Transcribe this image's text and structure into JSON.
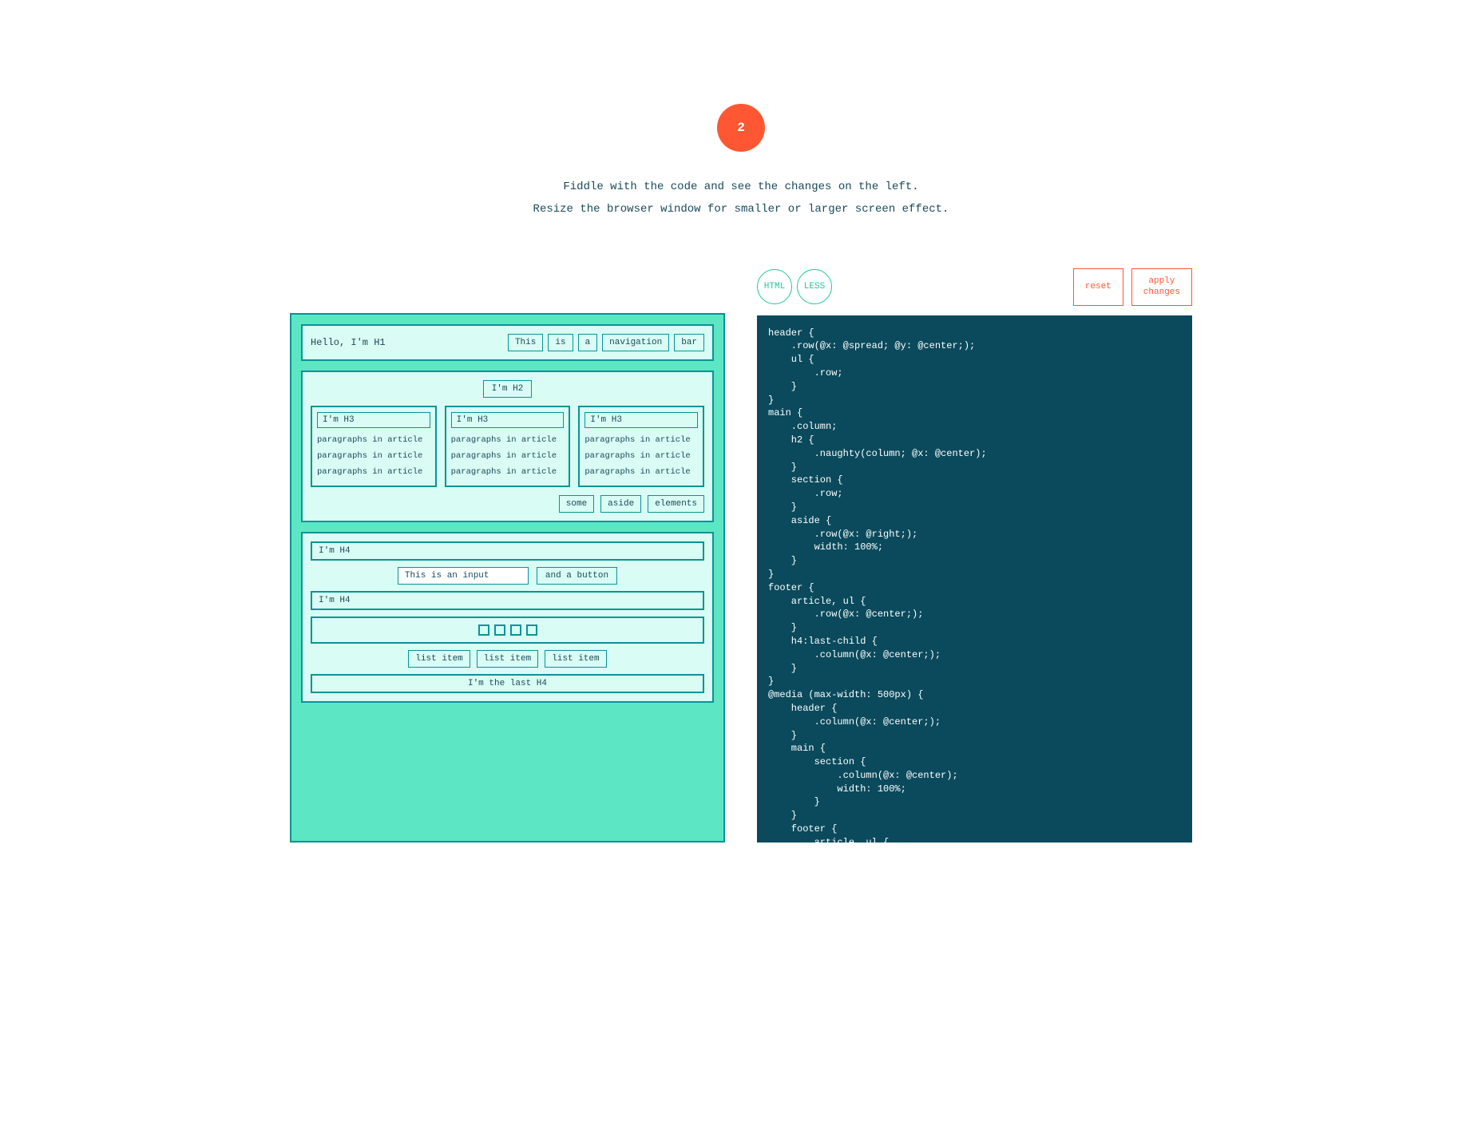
{
  "step": "2",
  "instructions": {
    "line1": "Fiddle with the code and see the changes on the left.",
    "line2": "Resize the browser window for smaller or larger screen effect."
  },
  "tabs": {
    "html": "HTML",
    "less": "LESS"
  },
  "actions": {
    "reset": "reset",
    "apply": "apply\nchanges"
  },
  "preview": {
    "h1": "Hello, I'm H1",
    "nav": [
      "This",
      "is",
      "a",
      "navigation",
      "bar"
    ],
    "h2": "I'm H2",
    "articles": [
      {
        "h3": "I'm H3",
        "p": [
          "paragraphs in article",
          "paragraphs in article",
          "paragraphs in article"
        ]
      },
      {
        "h3": "I'm H3",
        "p": [
          "paragraphs in article",
          "paragraphs in article",
          "paragraphs in article"
        ]
      },
      {
        "h3": "I'm H3",
        "p": [
          "paragraphs in article",
          "paragraphs in article",
          "paragraphs in article"
        ]
      }
    ],
    "aside": [
      "some",
      "aside",
      "elements"
    ],
    "footer": {
      "h4a": "I'm H4",
      "input_value": "This is an input",
      "button": "and a button",
      "h4b": "I'm H4",
      "list": [
        "list item",
        "list item",
        "list item"
      ],
      "h4_last": "I'm the last H4"
    }
  },
  "code": "header {\n    .row(@x: @spread; @y: @center;);\n    ul {\n        .row;\n    }\n}\nmain {\n    .column;\n    h2 {\n        .naughty(column; @x: @center);\n    }\n    section {\n        .row;\n    }\n    aside {\n        .row(@x: @right;);\n        width: 100%;\n    }\n}\nfooter {\n    article, ul {\n        .row(@x: @center;);\n    }\n    h4:last-child {\n        .column(@x: @center;);\n    }\n}\n@media (max-width: 500px) {\n    header {\n        .column(@x: @center;);\n    }\n    main {\n        section {\n            .column(@x: @center);\n            width: 100%;\n        }\n    }\n    footer {\n        article, ul {\n            .column(@x: @center;);\n        }\n    }\n}"
}
